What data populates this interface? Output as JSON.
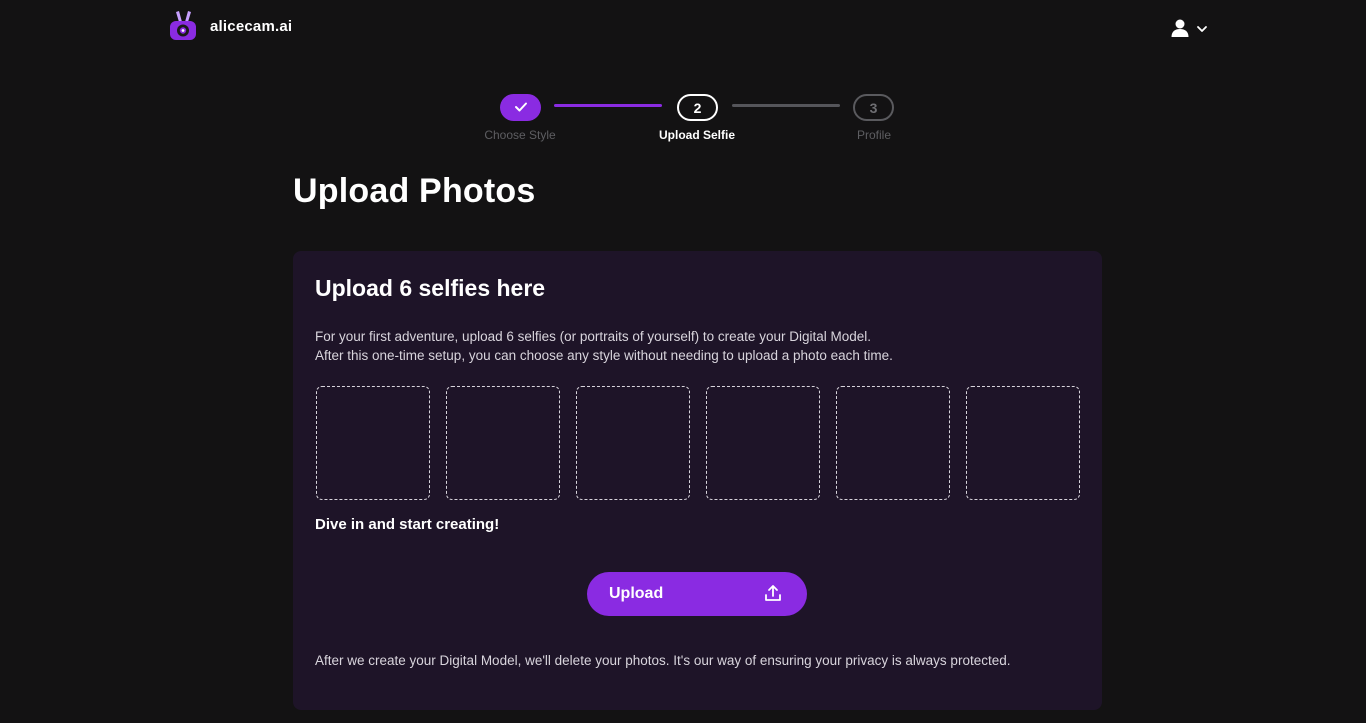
{
  "header": {
    "logo_text": "alicecam.ai",
    "logo_icon": "rabbit-camera-icon",
    "user_icon": "user-icon",
    "menu_icon": "chevron-down-icon"
  },
  "stepper": {
    "steps": [
      {
        "number": "",
        "label": "Choose Style",
        "state": "completed"
      },
      {
        "number": "2",
        "label": "Upload Selfie",
        "state": "active"
      },
      {
        "number": "3",
        "label": "Profile",
        "state": "pending"
      }
    ]
  },
  "main": {
    "title": "Upload Photos",
    "card": {
      "title": "Upload 6 selfies here",
      "desc_line1": "For your first adventure, upload 6 selfies (or portraits of yourself) to create your Digital Model.",
      "desc_line2": "After this one-time setup, you can choose any style without needing to upload a photo each time.",
      "slot_count": 6,
      "cta_text": "Dive in and start creating!",
      "upload_button_label": "Upload",
      "upload_icon": "upload-icon",
      "privacy_note": "After we create your Digital Model, we'll delete your photos. It's our way of ensuring your privacy is always protected."
    }
  },
  "colors": {
    "background": "#131213",
    "card": "#1e1428",
    "accent": "#8a2be2",
    "muted": "#5e5e62"
  }
}
